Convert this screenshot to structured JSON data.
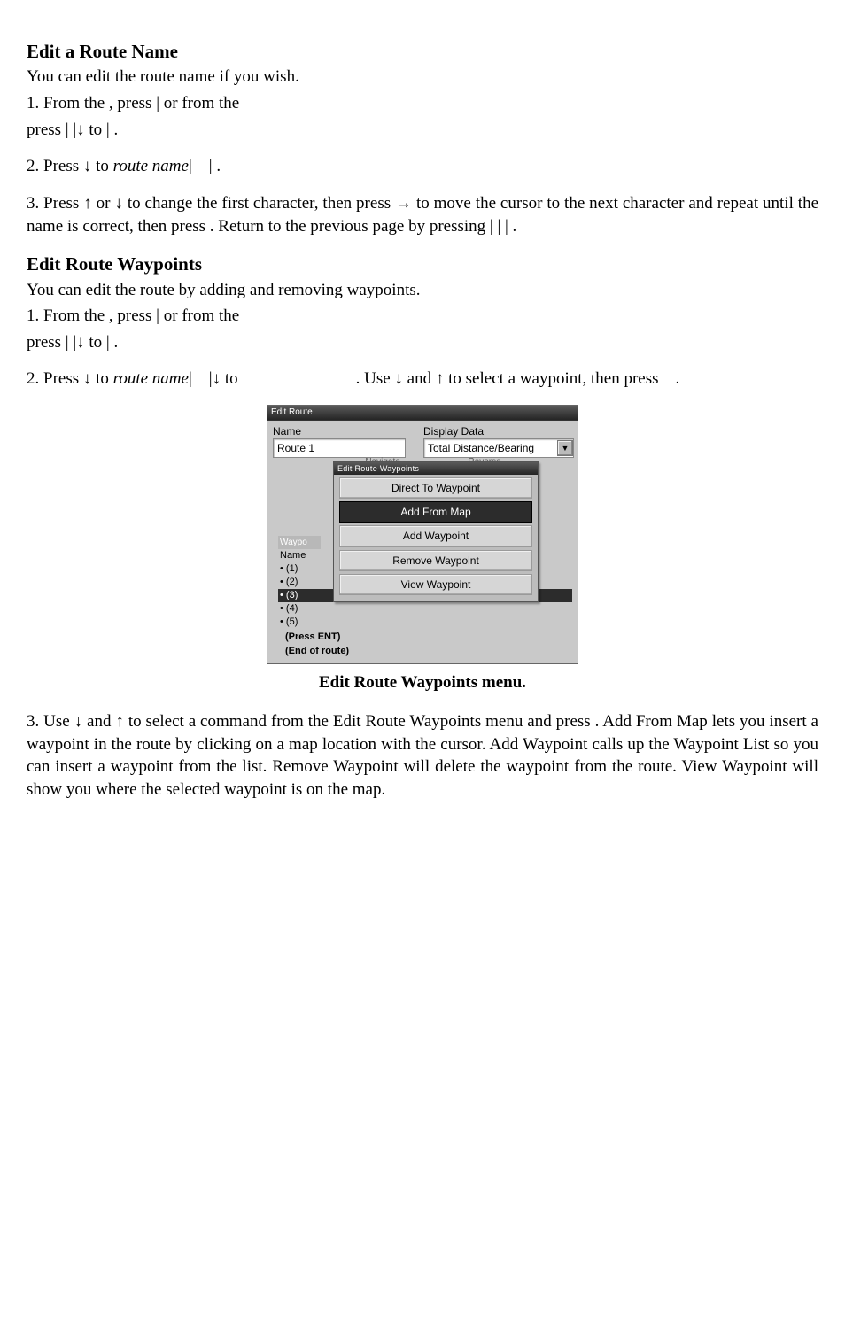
{
  "section1": {
    "heading": "Edit a Route Name",
    "intro": "You can edit the route name if you wish.",
    "step1_a": "1. From the ",
    "step1_press": ", press ",
    "step1_or": "|    or from the ",
    "step1_line2": "press     |     |↓ to          | .",
    "step2": "2. Press ↓ to route name|     | .",
    "step3": "3. Press ↑ or ↓ to change the first character, then press → to move the cursor to the next character and repeat until the name is correct, then press     .   Return   to   the   previous   page   by   pressing      |     |     | ."
  },
  "section2": {
    "heading": "Edit Route Waypoints",
    "intro": "You can edit the route by adding and removing waypoints.",
    "step1_line1": "1. From the                , press         |     or from the ",
    "step1_line2": "press     |     |↓ to          | .",
    "step2": "2. Press ↓ to route name|     |↓ to                    . Use ↓ and ↑ to select a waypoint, then press     .",
    "caption": "Edit Route Waypoints menu.",
    "step3": "3. Use ↓  and ↑ to select a command from the Edit Route Waypoints menu and press     . Add From Map lets you insert a waypoint in the route by clicking on a map location with the cursor. Add Waypoint calls up the Waypoint List so you can insert a waypoint from the list. Remove Waypoint will delete the waypoint from the route. View Waypoint will show you where the selected waypoint is on the map."
  },
  "dialog": {
    "title": "Edit Route",
    "name_label": "Name",
    "name_value": "Route 1",
    "dd_label": "Display Data",
    "dd_value": "Total Distance/Bearing",
    "peek_left": "Navigate",
    "peek_right": "Reverse",
    "popup_title": "Edit Route Waypoints",
    "menu": {
      "item1": "Direct To Waypoint",
      "item2": "Add From Map",
      "item3": "Add Waypoint",
      "item4": "Remove Waypoint",
      "item5": "View Waypoint"
    },
    "list": {
      "col_waypo": "Waypo",
      "col_name": "Name",
      "r1": "(1)",
      "r2": "(2)",
      "r3": "(3)",
      "r4": "(4)",
      "r5": "(5)",
      "hint1": "(Press ENT)",
      "hint2": "(End of route)"
    }
  }
}
